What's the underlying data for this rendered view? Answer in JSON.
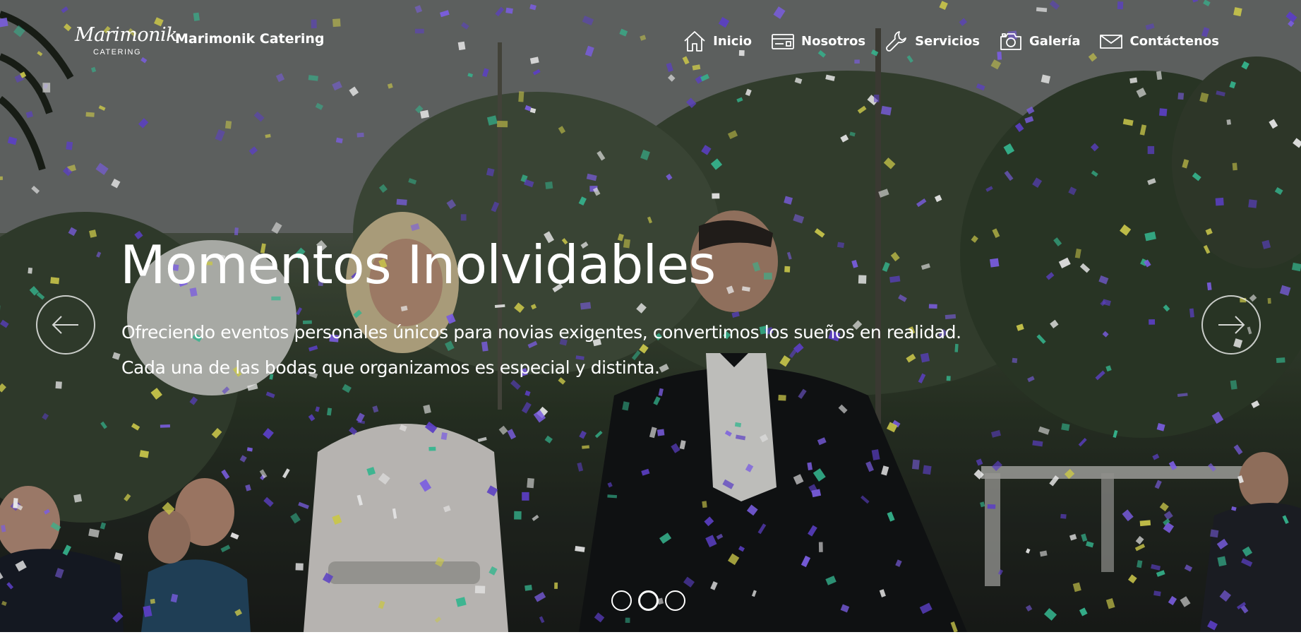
{
  "navbar": {
    "logo": {
      "script": "Marimonik",
      "sub": "CATERING"
    },
    "brand": "Marimonik Catering",
    "items": [
      {
        "label": "Inicio",
        "icon": "home-icon"
      },
      {
        "label": "Nosotros",
        "icon": "id-card-icon"
      },
      {
        "label": "Servicios",
        "icon": "wrench-icon"
      },
      {
        "label": "Galería",
        "icon": "camera-icon"
      },
      {
        "label": "Contáctenos",
        "icon": "envelope-icon"
      }
    ]
  },
  "carousel": {
    "title": "Momentos Inolvidables",
    "text_line1": "Ofreciendo eventos personales únicos para novias exigentes, convertimos los sueños en realidad.",
    "text_line2": "Cada una de las bodas que organizamos es especial y distinta.",
    "prev_icon": "arrow-left-icon",
    "next_icon": "arrow-right-icon",
    "slide_count": 3,
    "active_slide": 2
  },
  "colors": {
    "text": "#ffffff",
    "confetti": [
      "#5b3fc4",
      "#35b58e",
      "#c9c64a",
      "#e8e8e8",
      "#7a5de0"
    ]
  }
}
